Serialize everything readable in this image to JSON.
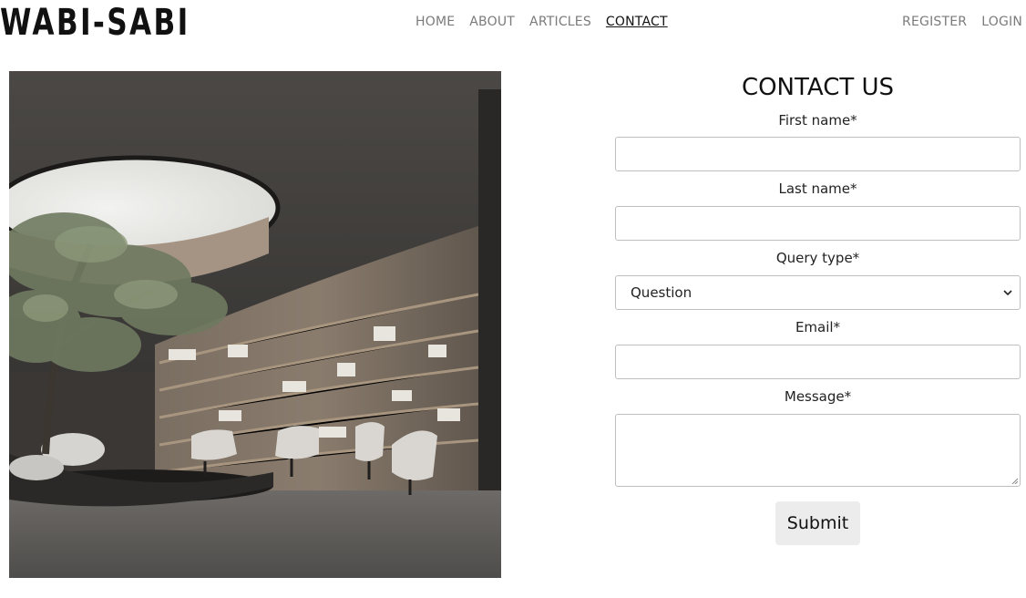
{
  "site": {
    "logo": "WABI-SABI"
  },
  "nav": {
    "main": [
      {
        "label": "HOME"
      },
      {
        "label": "ABOUT"
      },
      {
        "label": "ARTICLES"
      },
      {
        "label": "CONTACT"
      }
    ],
    "active": "CONTACT",
    "right": [
      {
        "label": "REGISTER"
      },
      {
        "label": "LOGIN"
      }
    ]
  },
  "form": {
    "title": "CONTACT US",
    "first_name_label": "First name*",
    "first_name_value": "",
    "last_name_label": "Last name*",
    "last_name_value": "",
    "query_type_label": "Query type*",
    "query_type_selected": "Question",
    "email_label": "Email*",
    "email_value": "",
    "message_label": "Message*",
    "message_value": "",
    "submit_label": "Submit"
  },
  "colors": {
    "link": "#7b7b7b",
    "active_link": "#111111",
    "button_bg": "#ececec",
    "input_border": "#bfbfbf"
  }
}
